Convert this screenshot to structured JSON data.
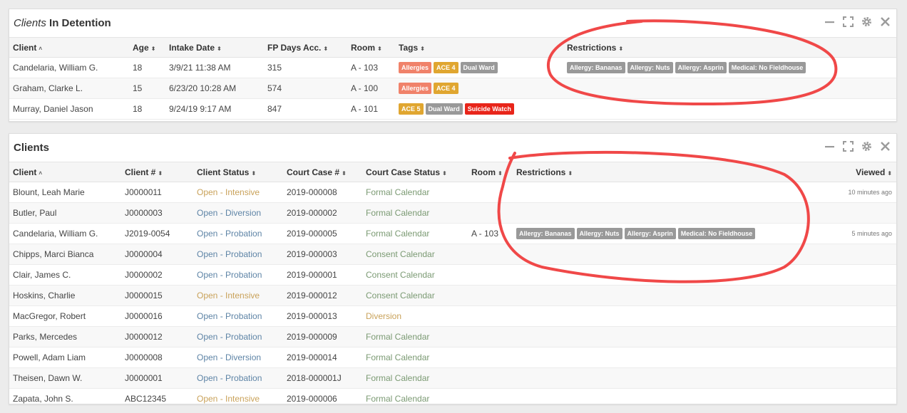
{
  "detention": {
    "title_italic": "Clients",
    "title_bold": "In Detention",
    "columns": [
      "Client",
      "Age",
      "Intake Date",
      "FP Days Acc.",
      "Room",
      "Tags",
      "Restrictions"
    ],
    "rows": [
      {
        "client": "Candelaria, William G.",
        "age": "18",
        "intake": "3/9/21 11:38 AM",
        "fp": "315",
        "room": "A - 103",
        "tags": [
          {
            "t": "Allergies",
            "c": "salmon"
          },
          {
            "t": "ACE 4",
            "c": "amber"
          },
          {
            "t": "Dual Ward",
            "c": "grey"
          }
        ],
        "restrictions": [
          "Allergy: Bananas",
          "Allergy: Nuts",
          "Allergy: Asprin",
          "Medical: No Fieldhouse"
        ]
      },
      {
        "client": "Graham, Clarke L.",
        "age": "15",
        "intake": "6/23/20 10:28 AM",
        "fp": "574",
        "room": "A - 100",
        "tags": [
          {
            "t": "Allergies",
            "c": "salmon"
          },
          {
            "t": "ACE 4",
            "c": "amber"
          }
        ],
        "restrictions": []
      },
      {
        "client": "Murray, Daniel Jason",
        "age": "18",
        "intake": "9/24/19 9:17 AM",
        "fp": "847",
        "room": "A - 101",
        "tags": [
          {
            "t": "ACE 5",
            "c": "amber"
          },
          {
            "t": "Dual Ward",
            "c": "grey"
          },
          {
            "t": "Suicide Watch",
            "c": "red"
          }
        ],
        "restrictions": []
      }
    ]
  },
  "clients": {
    "title": "Clients",
    "columns": [
      "Client",
      "Client #",
      "Client Status",
      "Court Case #",
      "Court Case Status",
      "Room",
      "Restrictions",
      "Viewed"
    ],
    "rows": [
      {
        "client": "Blount, Leah Marie",
        "num": "J0000011",
        "status": "Open - Intensive",
        "sc": "intensive",
        "case": "2019-000008",
        "ccs": "Formal Calendar",
        "ccc": "green",
        "room": "",
        "restrictions": [],
        "viewed": "10 minutes ago"
      },
      {
        "client": "Butler, Paul",
        "num": "J0000003",
        "status": "Open - Diversion",
        "sc": "blue",
        "case": "2019-000002",
        "ccs": "Formal Calendar",
        "ccc": "green",
        "room": "",
        "restrictions": [],
        "viewed": ""
      },
      {
        "client": "Candelaria, William G.",
        "num": "J2019-0054",
        "status": "Open - Probation",
        "sc": "blue",
        "case": "2019-000005",
        "ccs": "Formal Calendar",
        "ccc": "green",
        "room": "A - 103",
        "restrictions": [
          "Allergy: Bananas",
          "Allergy: Nuts",
          "Allergy: Asprin",
          "Medical: No Fieldhouse"
        ],
        "viewed": "5 minutes ago"
      },
      {
        "client": "Chipps, Marci Bianca",
        "num": "J0000004",
        "status": "Open - Probation",
        "sc": "blue",
        "case": "2019-000003",
        "ccs": "Consent Calendar",
        "ccc": "green",
        "room": "",
        "restrictions": [],
        "viewed": ""
      },
      {
        "client": "Clair, James C.",
        "num": "J0000002",
        "status": "Open - Probation",
        "sc": "blue",
        "case": "2019-000001",
        "ccs": "Consent Calendar",
        "ccc": "green",
        "room": "",
        "restrictions": [],
        "viewed": ""
      },
      {
        "client": "Hoskins, Charlie",
        "num": "J0000015",
        "status": "Open - Intensive",
        "sc": "intensive",
        "case": "2019-000012",
        "ccs": "Consent Calendar",
        "ccc": "green",
        "room": "",
        "restrictions": [],
        "viewed": ""
      },
      {
        "client": "MacGregor, Robert",
        "num": "J0000016",
        "status": "Open - Probation",
        "sc": "blue",
        "case": "2019-000013",
        "ccs": "Diversion",
        "ccc": "amber",
        "room": "",
        "restrictions": [],
        "viewed": ""
      },
      {
        "client": "Parks, Mercedes",
        "num": "J0000012",
        "status": "Open - Probation",
        "sc": "blue",
        "case": "2019-000009",
        "ccs": "Formal Calendar",
        "ccc": "green",
        "room": "",
        "restrictions": [],
        "viewed": ""
      },
      {
        "client": "Powell, Adam Liam",
        "num": "J0000008",
        "status": "Open - Diversion",
        "sc": "blue",
        "case": "2019-000014",
        "ccs": "Formal Calendar",
        "ccc": "green",
        "room": "",
        "restrictions": [],
        "viewed": ""
      },
      {
        "client": "Theisen, Dawn W.",
        "num": "J0000001",
        "status": "Open - Probation",
        "sc": "blue",
        "case": "2018-000001J",
        "ccs": "Formal Calendar",
        "ccc": "green",
        "room": "",
        "restrictions": [],
        "viewed": ""
      },
      {
        "client": "Zapata, John S.",
        "num": "ABC12345",
        "status": "Open - Intensive",
        "sc": "intensive",
        "case": "2019-000006",
        "ccs": "Formal Calendar",
        "ccc": "green",
        "room": "",
        "restrictions": [],
        "viewed": ""
      }
    ]
  },
  "colors": {
    "annotation": "#f04848",
    "tag_grey": "#999999",
    "tag_salmon": "#f0826a",
    "tag_amber": "#e0a630",
    "tag_red": "#e8251a"
  },
  "icons": [
    "minimize-icon",
    "expand-icon",
    "gear-icon",
    "close-icon",
    "sort-icon"
  ]
}
